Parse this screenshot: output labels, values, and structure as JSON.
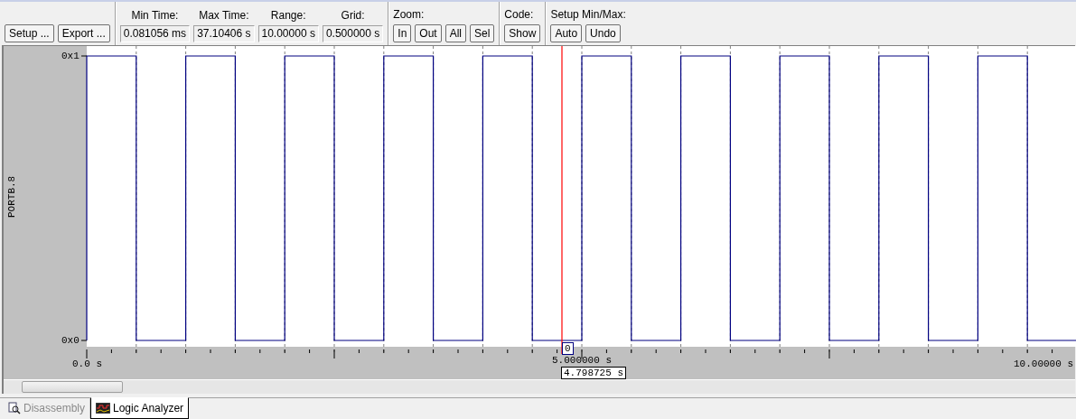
{
  "toolbar": {
    "buttons": [
      {
        "label": "Setup ..."
      },
      {
        "label": "Export ..."
      }
    ],
    "fields": [
      {
        "label": "Min Time:",
        "value": "0.081056 ms"
      },
      {
        "label": "Max Time:",
        "value": "37.10406 s"
      },
      {
        "label": "Range:",
        "value": "10.00000 s"
      },
      {
        "label": "Grid:",
        "value": "0.500000 s"
      }
    ],
    "groups": [
      {
        "label": "Zoom:",
        "buttons": [
          "In",
          "Out",
          "All",
          "Sel"
        ]
      },
      {
        "label": "Code:",
        "buttons": [
          "Show"
        ]
      },
      {
        "label": "Setup Min/Max:",
        "buttons": [
          "Auto",
          "Undo"
        ]
      }
    ]
  },
  "analyzer": {
    "signal": "PORTB.8",
    "y_labels": [
      "0x1",
      "0x0"
    ],
    "x_labels": [
      "0.0 s",
      "5.000000 s",
      "10.00000 s"
    ],
    "cursor_value": "0",
    "cursor_time": "4.798725 s"
  },
  "tabs": [
    {
      "label": "Disassembly",
      "selected": false
    },
    {
      "label": "Logic Analyzer",
      "selected": true
    }
  ]
}
